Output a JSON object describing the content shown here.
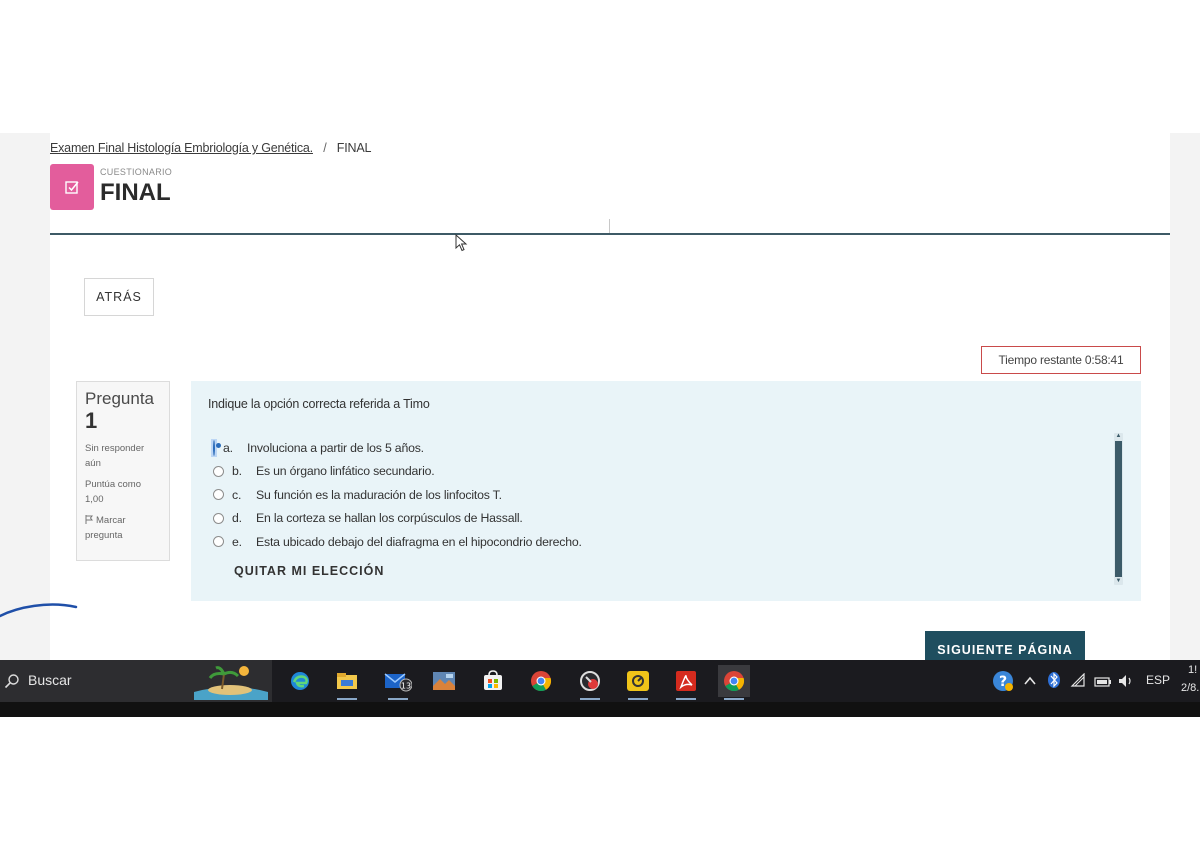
{
  "breadcrumb": {
    "course": "Examen Final Histología Embriología y Genética.",
    "separator": "/",
    "current": "FINAL"
  },
  "header": {
    "activity_type": "CUESTIONARIO",
    "title": "FINAL",
    "icon": "quiz-checkbox-icon"
  },
  "nav": {
    "back_label": "ATRÁS",
    "next_label": "SIGUIENTE PÁGINA"
  },
  "timer": {
    "text": "Tiempo restante 0:58:41"
  },
  "question_info": {
    "label": "Pregunta",
    "number": "1",
    "status": "Sin responder aún",
    "score": "Puntúa como 1,00",
    "flag_label": "Marcar pregunta"
  },
  "question": {
    "text": "Indique la opción correcta referida a Timo",
    "options": [
      {
        "letter": "a.",
        "text": "Involuciona a partir de los 5 años.",
        "selected": true
      },
      {
        "letter": "b.",
        "text": "Es un órgano linfático secundario.",
        "selected": false
      },
      {
        "letter": "c.",
        "text": "Su función es la maduración de los linfocitos T.",
        "selected": false
      },
      {
        "letter": "d.",
        "text": "En la corteza se hallan los corpúsculos de Hassall.",
        "selected": false
      },
      {
        "letter": "e.",
        "text": "Esta ubicado debajo del diafragma en el hipocondrio derecho.",
        "selected": false
      }
    ],
    "clear_label": "QUITAR MI ELECCIÓN"
  },
  "taskbar": {
    "search_label": "Buscar",
    "apps": [
      "edge-icon",
      "file-explorer-icon",
      "mail-icon",
      "photos-icon",
      "store-icon",
      "chrome-icon",
      "app-icon",
      "snagit-icon",
      "acrobat-icon",
      "chrome-icon"
    ],
    "mail_badge": "13",
    "tray": {
      "language": "ESP",
      "time": "1!",
      "date": "2/8."
    }
  },
  "colors": {
    "accent": "#e35d9c",
    "primary_button": "#1f4e5f",
    "question_bg": "#e9f4f8",
    "timer_border": "#c94a4a"
  }
}
